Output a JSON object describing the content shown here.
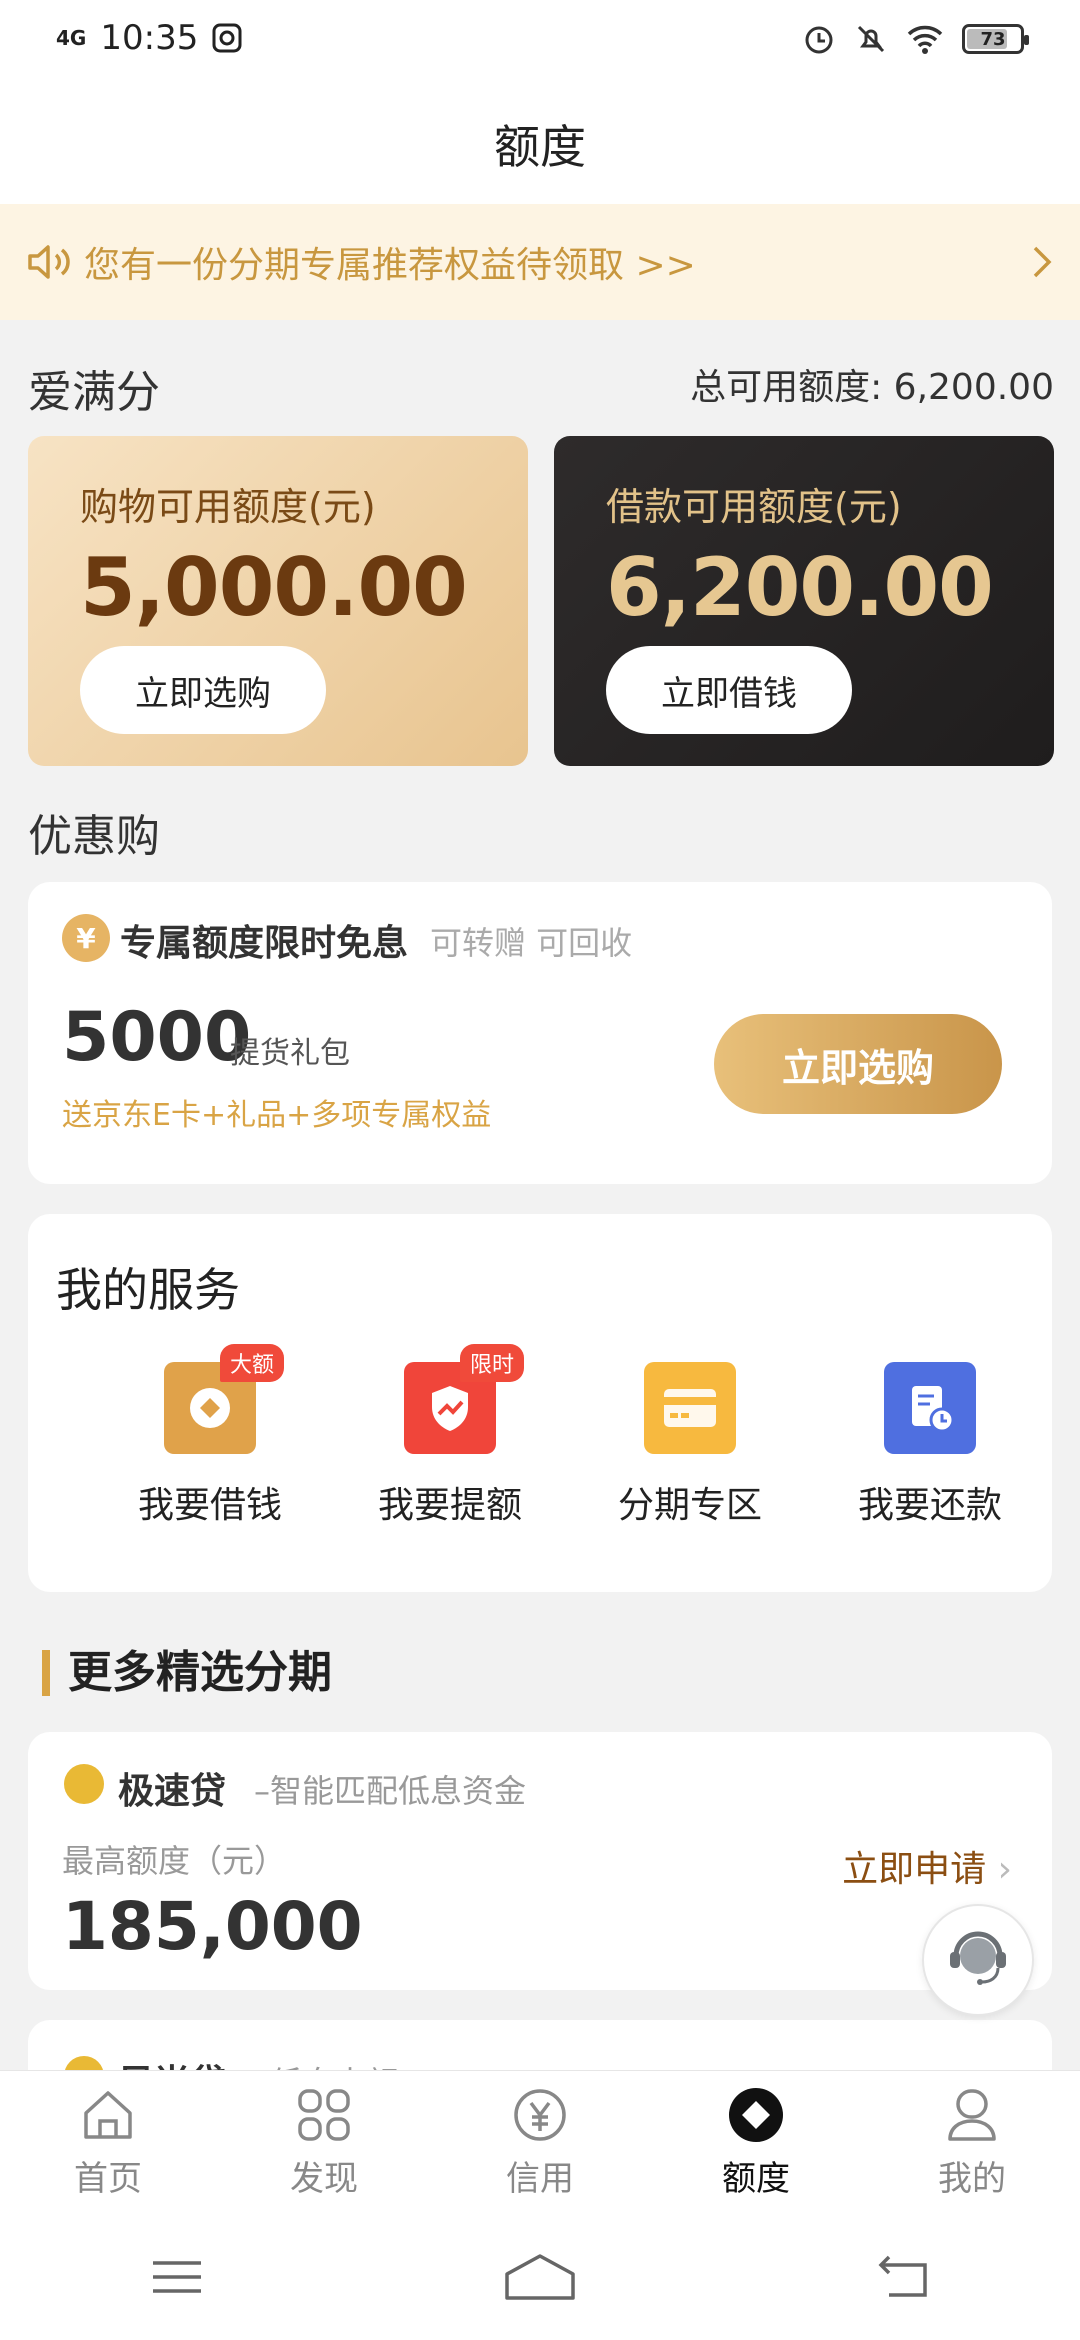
{
  "status_bar": {
    "network": "4G",
    "time": "10:35",
    "battery": "73"
  },
  "header": {
    "title": "额度"
  },
  "notice": {
    "text": "您有一份分期专属推荐权益待领取 >>"
  },
  "credit": {
    "title": "爱满分",
    "total_label": "总可用额度: 6,200.00",
    "shopping": {
      "label": "购物可用额度(元)",
      "amount": "5,000.00",
      "button": "立即选购"
    },
    "loan": {
      "label": "借款可用额度(元)",
      "amount": "6,200.00",
      "button": "立即借钱"
    }
  },
  "promo": {
    "section_title": "优惠购",
    "coin_icon": "¥",
    "headline": "专属额度限时免息",
    "tags": "可转赠 可回收",
    "amount": "5000",
    "amount_unit": "提货礼包",
    "gift_text": "送京东E卡+礼品+多项专属权益",
    "button": "立即选购"
  },
  "services": {
    "title": "我的服务",
    "items": [
      {
        "label": "我要借钱",
        "badge": "大额",
        "color": "#e0a24a"
      },
      {
        "label": "我要提额",
        "badge": "限时",
        "color": "#f0453a"
      },
      {
        "label": "分期专区",
        "badge": "",
        "color": "#f7b93f"
      },
      {
        "label": "我要还款",
        "badge": "",
        "color": "#4f6fe0"
      }
    ]
  },
  "more": {
    "title": "更多精选分期",
    "loan": {
      "name": "极速贷",
      "desc": "–智能匹配低息资金",
      "limit_label": "最高额度（元）",
      "amount": "185,000",
      "apply": "立即申请"
    },
    "loan2": {
      "name": "风尚贷",
      "desc": "–低息大额"
    }
  },
  "tabs": [
    {
      "label": "首页",
      "icon": "home-icon"
    },
    {
      "label": "发现",
      "icon": "grid-icon"
    },
    {
      "label": "信用",
      "icon": "yen-icon"
    },
    {
      "label": "额度",
      "icon": "diamond-icon"
    },
    {
      "label": "我的",
      "icon": "profile-icon"
    }
  ]
}
